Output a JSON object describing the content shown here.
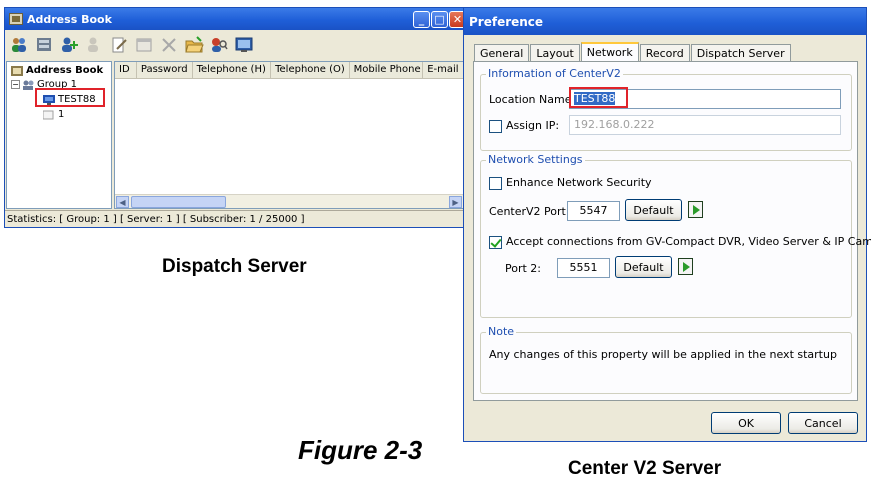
{
  "address_book": {
    "title": "Address Book",
    "toolbar_icons": [
      "users-icon",
      "server-icon",
      "add-user-icon",
      "user-disabled-icon",
      "edit-icon",
      "window-icon",
      "delete-icon",
      "folder-open-icon",
      "search-user-icon",
      "monitor-icon"
    ],
    "tree": {
      "root": "Address Book",
      "group": "Group 1",
      "server": "TEST88",
      "subscriber": "1"
    },
    "columns": [
      "ID",
      "Password",
      "Telephone (H)",
      "Telephone (O)",
      "Mobile Phone",
      "E-mail"
    ],
    "status": "Statistics: [ Group: 1 ]  [ Server: 1 ]  [ Subscriber: 1 / 25000 ]"
  },
  "captions": {
    "dispatch": "Dispatch Server",
    "figure": "Figure 2-3",
    "center": "Center V2 Server"
  },
  "preference": {
    "title": "Preference",
    "tabs": [
      "General",
      "Layout",
      "Network",
      "Record",
      "Dispatch Server"
    ],
    "active_tab": "Network",
    "info": {
      "legend": "Information of CenterV2",
      "location_label": "Location Name:",
      "location_value": "TEST88",
      "assign_ip_label": "Assign IP:",
      "assign_ip_checked": false,
      "assign_ip_value": "192.168.0.222"
    },
    "network": {
      "legend": "Network Settings",
      "enhance_label": "Enhance Network Security",
      "enhance_checked": false,
      "port_label": "CenterV2 Port:",
      "port_value": "5547",
      "default_label": "Default",
      "accept_label": "Accept connections from GV-Compact DVR, Video Server & IP Cam",
      "accept_checked": true,
      "port2_label": "Port 2:",
      "port2_value": "5551",
      "default2_label": "Default"
    },
    "note": {
      "legend": "Note",
      "text": "Any changes of this property will be applied in the next startup"
    },
    "ok_label": "OK",
    "cancel_label": "Cancel"
  },
  "colors": {
    "title_blue": "#1f5fd8",
    "highlight_red": "#e0232a",
    "group_legend_blue": "#1f4fb0",
    "selection_blue": "#316ac5"
  }
}
